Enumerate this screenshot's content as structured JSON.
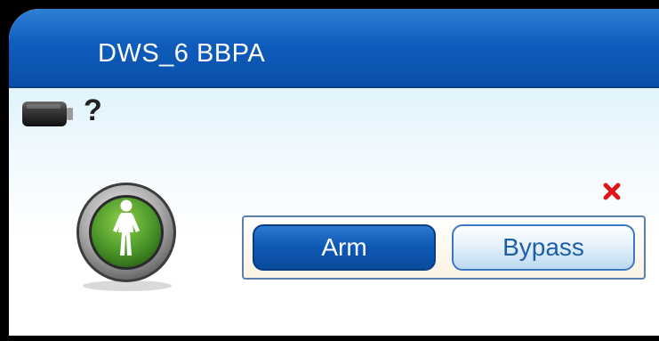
{
  "window": {
    "title": "DWS_6 BBPA"
  },
  "status": {
    "battery_icon": "battery-icon",
    "battery_state": "?",
    "zone_icon": "walking-person-icon"
  },
  "actions": {
    "arm_label": "Arm",
    "bypass_label": "Bypass",
    "close_icon": "close-x-icon"
  },
  "colors": {
    "header_blue": "#0f5cbc",
    "arm_button_blue": "#0d58b4",
    "zone_icon_green": "#4f9a2c",
    "close_red": "#e01616"
  }
}
